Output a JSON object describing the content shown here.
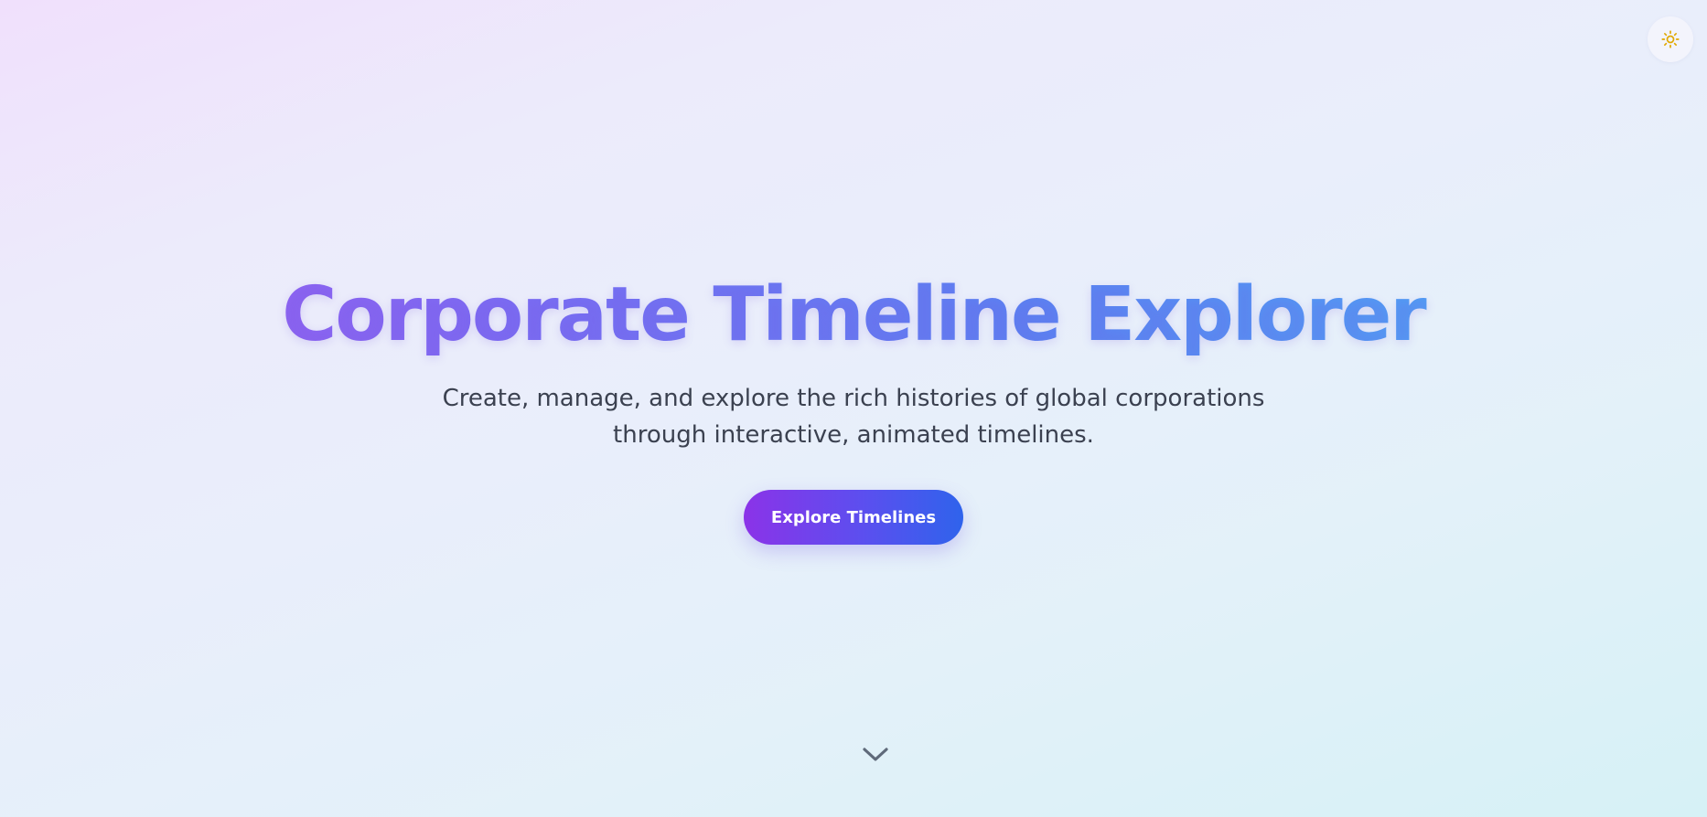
{
  "theme_toggle": {
    "icon": "sun-icon",
    "icon_color": "#e0a800"
  },
  "hero": {
    "title": "Corporate Timeline Explorer",
    "subtitle_line1": "Create, manage, and explore the rich histories of global corporations",
    "subtitle_line2": "through interactive, animated timelines.",
    "cta_label": "Explore Timelines"
  },
  "scroll_indicator": {
    "icon": "chevron-down-icon"
  },
  "colors": {
    "gradient_start": "#a259f0",
    "gradient_end": "#4bb0f6",
    "button_start": "#8b33e8",
    "button_end": "#2f63ec",
    "text": "#3b4150"
  }
}
